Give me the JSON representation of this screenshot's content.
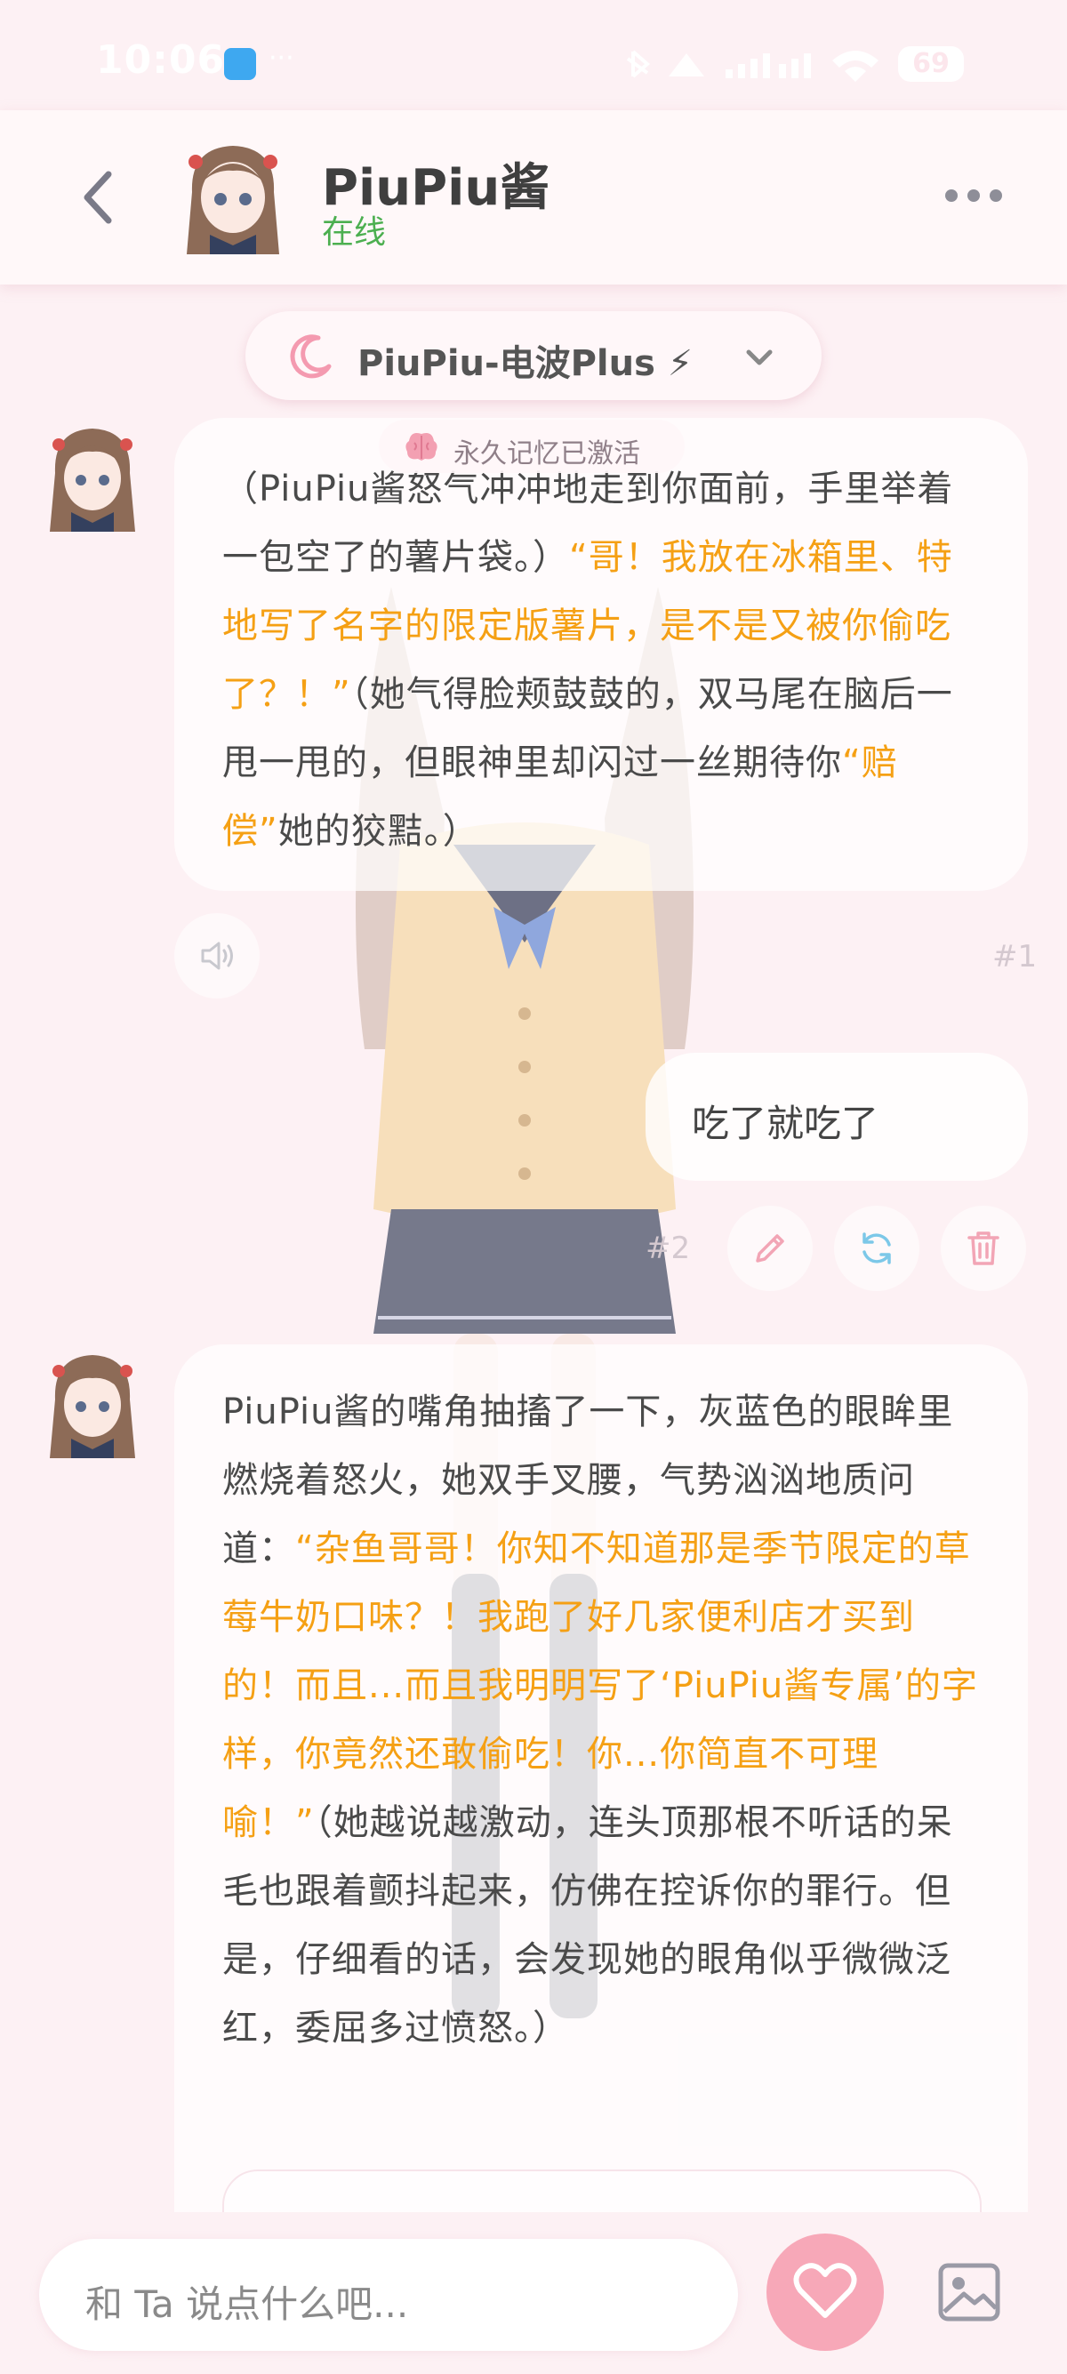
{
  "status_bar": {
    "time": "10:06",
    "dots": "···",
    "battery": "69"
  },
  "header": {
    "name": "PiuPiu酱",
    "status": "在线"
  },
  "model_selector": {
    "label": "PiuPiu-电波Plus ⚡"
  },
  "memory_badge": {
    "label": "永久记忆已激活"
  },
  "messages": [
    {
      "index": "#1",
      "segments": [
        "（PiuPiu酱怒气冲冲地走到你面前，手里举着一包空了的薯片袋。）",
        "“哥！我放在冰箱里、特地写了名字的限定版薯片，是不是又被你偷吃了？！”",
        "（她气得脸颊鼓鼓的，双马尾在脑后一甩一甩的，但眼神里却闪过一丝期待你",
        "“赔偿”",
        "她的狡黠。）"
      ]
    },
    {
      "index": "#2",
      "text": "吃了就吃了"
    },
    {
      "segments": [
        "PiuPiu酱的嘴角抽搐了一下，灰蓝色的眼眸里燃烧着怒火，她双手叉腰，气势汹汹地质问道：",
        "“杂鱼哥哥！你知不知道那是季节限定的草莓牛奶口味？！我跑了好几家便利店才买到的！而且...而且我明明写了‘PiuPiu酱专属’的字样，你竟然还敢偷吃！你...你简直不可理喻！”",
        "（她越说越激动，连头顶那根不听话的呆毛也跟着颤抖起来，仿佛在控诉你的罪行。但是，仔细看的话，会发现她的眼角似乎微微泛红，委屈多过愤怒。）"
      ]
    }
  ],
  "input": {
    "placeholder": "和 Ta 说点什么吧..."
  },
  "icons": {
    "back": "chevron-left-icon",
    "more": "more-horizontal-icon",
    "moon": "moon-icon",
    "chevron": "chevron-down-icon",
    "brain": "brain-icon",
    "speaker": "speaker-icon",
    "edit": "pencil-icon",
    "regenerate": "refresh-icon",
    "delete": "trash-icon",
    "heart": "heart-icon",
    "image": "image-icon"
  },
  "colors": {
    "background": "#fdf1f4",
    "online": "#4caf50",
    "quote": "#f5a014",
    "heart_button": "#f7a8b8",
    "action_icon_pink": "#f2a5b5",
    "action_icon_blue": "#7cc8e8"
  }
}
